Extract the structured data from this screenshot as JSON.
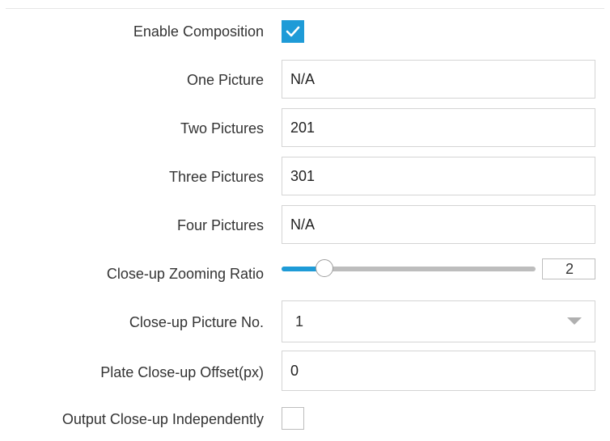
{
  "form": {
    "enable_composition": {
      "label": "Enable Composition",
      "checked": true
    },
    "one_picture": {
      "label": "One Picture",
      "value": "N/A"
    },
    "two_pictures": {
      "label": "Two Pictures",
      "value": "201"
    },
    "three_pictures": {
      "label": "Three Pictures",
      "value": "301"
    },
    "four_pictures": {
      "label": "Four Pictures",
      "value": "N/A"
    },
    "closeup_zoom_ratio": {
      "label": "Close-up Zooming Ratio",
      "value": "2",
      "slider_fraction": 0.17
    },
    "closeup_picture_no": {
      "label": "Close-up Picture No.",
      "selected": "1"
    },
    "plate_closeup_offset": {
      "label": "Plate Close-up Offset(px)",
      "value": "0"
    },
    "output_closeup_independently": {
      "label": "Output Close-up Independently",
      "checked": false
    }
  },
  "colors": {
    "accent": "#1e9bd7",
    "border": "#d4d4d4",
    "text": "#333333"
  },
  "icons": {
    "check": "check-icon",
    "dropdown": "chevron-down-icon"
  }
}
